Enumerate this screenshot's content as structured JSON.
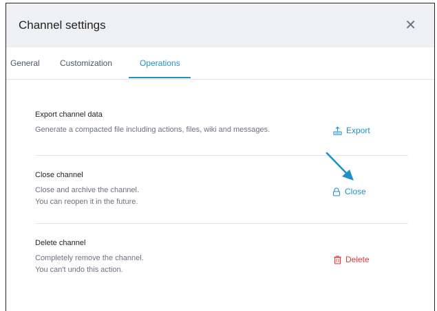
{
  "dialog": {
    "title": "Channel settings",
    "close_icon": "close-icon"
  },
  "tabs": [
    {
      "label": "General",
      "active": false
    },
    {
      "label": "Customization",
      "active": false
    },
    {
      "label": "Operations",
      "active": true
    }
  ],
  "sections": {
    "export": {
      "title": "Export channel data",
      "description": "Generate a compacted file including actions, files, wiki and messages.",
      "action_label": "Export",
      "action_icon": "export-icon"
    },
    "close": {
      "title": "Close channel",
      "description_line1": "Close and archive the channel.",
      "description_line2": "You can reopen it in the future.",
      "action_label": "Close",
      "action_icon": "lock-icon"
    },
    "delete": {
      "title": "Delete channel",
      "description_line1": "Completely remove the channel.",
      "description_line2": "You can't undo this action.",
      "action_label": "Delete",
      "action_icon": "trash-icon"
    }
  },
  "colors": {
    "accent": "#1f8fc7",
    "danger": "#e0393e",
    "header_bg": "#eef0f3"
  }
}
